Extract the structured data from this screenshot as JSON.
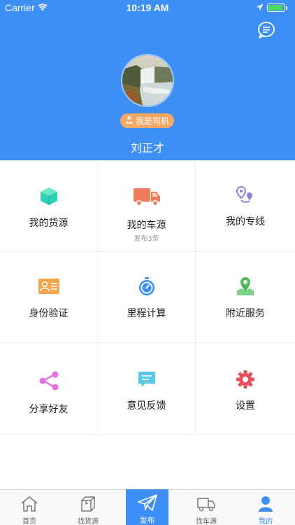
{
  "status_bar": {
    "carrier": "Carrier",
    "time": "10:19 AM"
  },
  "profile": {
    "role_badge": "我是司机",
    "name": "刘正才"
  },
  "grid": [
    {
      "label": "我的货源",
      "sub": ""
    },
    {
      "label": "我的车源",
      "sub": "发布3条"
    },
    {
      "label": "我的专线",
      "sub": ""
    },
    {
      "label": "身份验证",
      "sub": ""
    },
    {
      "label": "里程计算",
      "sub": ""
    },
    {
      "label": "附近服务",
      "sub": ""
    },
    {
      "label": "分享好友",
      "sub": ""
    },
    {
      "label": "意见反馈",
      "sub": ""
    },
    {
      "label": "设置",
      "sub": ""
    }
  ],
  "tabbar": [
    {
      "label": "首页"
    },
    {
      "label": "找货源"
    },
    {
      "label": "发布"
    },
    {
      "label": "找车源"
    },
    {
      "label": "我的"
    }
  ],
  "colors": {
    "primary": "#3d8ef5",
    "badge": "#f4a864",
    "battery": "#4cd964"
  },
  "icons": [
    "wifi-icon",
    "location-arrow-icon",
    "battery-icon",
    "message-icon",
    "driver-icon",
    "cube-icon",
    "truck-icon",
    "route-icon",
    "id-card-icon",
    "stopwatch-icon",
    "map-pin-icon",
    "share-icon",
    "chat-icon",
    "gear-icon",
    "home-icon",
    "box-icon",
    "send-icon",
    "delivery-truck-icon",
    "user-icon"
  ]
}
